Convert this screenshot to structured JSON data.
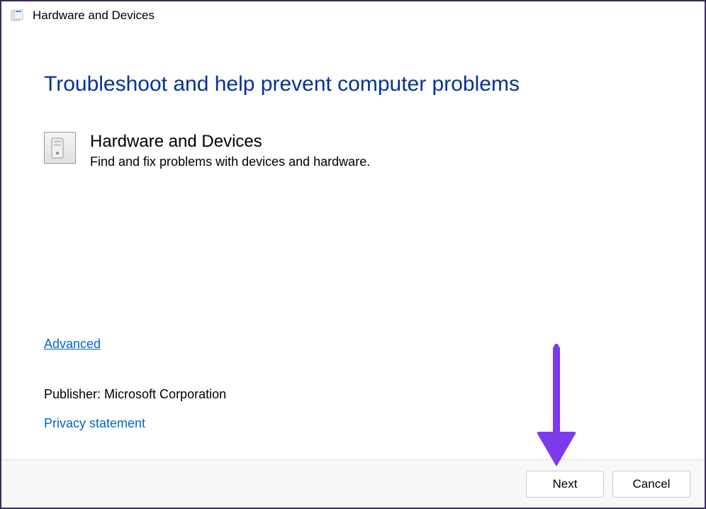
{
  "window": {
    "title": "Hardware and Devices"
  },
  "content": {
    "heading": "Troubleshoot and help prevent computer problems",
    "troubleshooter": {
      "title": "Hardware and Devices",
      "description": "Find and fix problems with devices and hardware."
    },
    "advanced_link": "Advanced",
    "publisher_label": "Publisher:  Microsoft Corporation",
    "privacy_link": "Privacy statement"
  },
  "footer": {
    "next_label": "Next",
    "cancel_label": "Cancel"
  }
}
